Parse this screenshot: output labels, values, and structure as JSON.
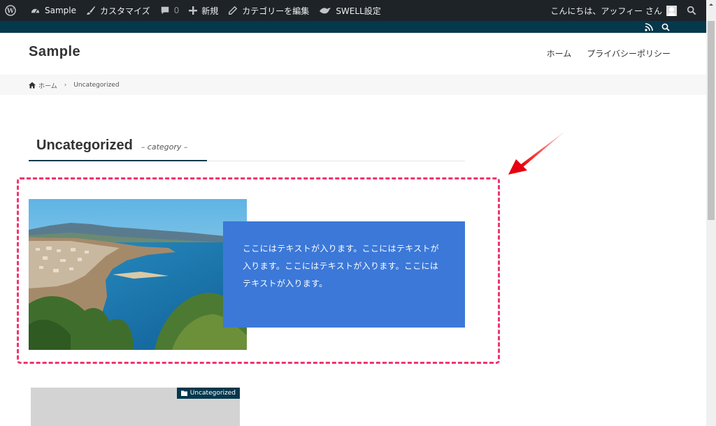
{
  "admin_bar": {
    "site_name": "Sample",
    "customize": "カスタマイズ",
    "comments_count": "0",
    "new": "新規",
    "edit_category": "カテゴリーを編集",
    "swell_settings": "SWELL設定",
    "greeting": "こんにちは、アッフィー さん"
  },
  "header": {
    "site_title": "Sample",
    "nav": [
      "ホーム",
      "プライバシーポリシー"
    ]
  },
  "breadcrumb": {
    "home": "ホーム",
    "current": "Uncategorized"
  },
  "archive": {
    "title": "Uncategorized",
    "subtitle": "– category –"
  },
  "featured": {
    "text": "ここにはテキストが入ります。ここにはテキストが入ります。ここにはテキストが入ります。ここにはテキストが入ります。"
  },
  "card": {
    "category": "Uncategorized"
  },
  "colors": {
    "admin_bar": "#1d2327",
    "brand_dark": "#04384c",
    "text_box": "#3b78d8",
    "highlight": "#f0356e"
  }
}
